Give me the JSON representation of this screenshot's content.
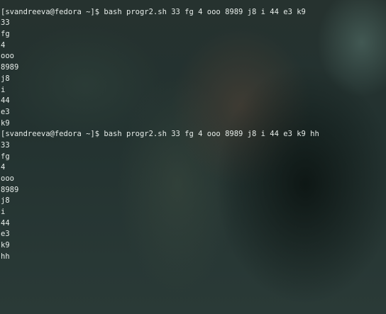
{
  "terminal": {
    "lines": [
      "",
      "[svandreeva@fedora ~]$ bash progr2.sh 33 fg 4 ooo 8989 j8 i 44 e3 k9",
      "33",
      "fg",
      "4",
      "ooo",
      "8989",
      "j8",
      "i",
      "44",
      "e3",
      "k9",
      "[svandreeva@fedora ~]$ bash progr2.sh 33 fg 4 ooo 8989 j8 i 44 e3 k9 hh",
      "33",
      "fg",
      "4",
      "ooo",
      "8989",
      "j8",
      "i",
      "44",
      "e3",
      "k9",
      "hh"
    ]
  }
}
